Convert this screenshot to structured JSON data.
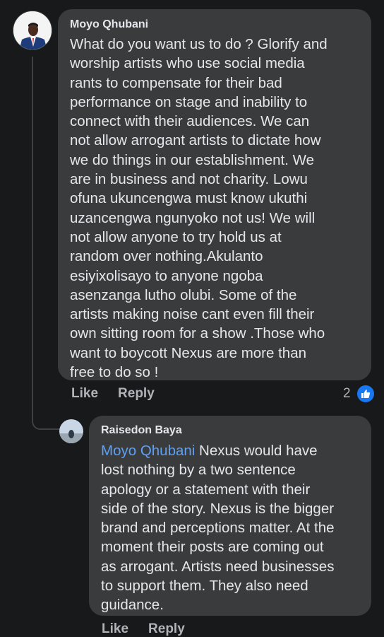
{
  "comment": {
    "author": "Moyo Qhubani",
    "text": "What do you want us to do ? Glorify and\nworship artists who use social media\nrants to compensate for their bad\nperformance on stage  and inability to\nconnect with their audiences. We can\nnot allow arrogant artists to dictate how\nwe do things in our establishment. We\nare in business and not charity. Lowu\nofuna ukuncengwa must know ukuthi\nuzancengwa ngunyoko not us!  We will\nnot allow anyone to try hold us at\nrandom over nothing.Akulanto\nesiyixolisayo to anyone ngoba\nasenzanga lutho olubi. Some of the\nartists making noise cant even fill their\nown  sitting room for a show .Those who\nwant to boycott Nexus are more than\nfree to do so !",
    "like_label": "Like",
    "reply_label": "Reply",
    "reaction_count": "2",
    "reaction_icon": "thumbs-up-icon"
  },
  "reply": {
    "author": "Raisedon Baya",
    "mention": "Moyo Qhubani",
    "text": " Nexus would have\nlost nothing by a two sentence\napology or a statement with their\nside of the story. Nexus is the bigger\nbrand and perceptions matter. At the\nmoment their posts are coming out\nas arrogant. Artists need businesses\nto support them. They also need\nguidance.",
    "like_label": "Like",
    "reply_label": "Reply"
  },
  "colors": {
    "background": "#18191a",
    "bubble": "#3a3b3c",
    "text": "#e4e6eb",
    "secondary_text": "#b0b3b8",
    "mention": "#5ea0f5",
    "like_blue": "#1877f2"
  }
}
